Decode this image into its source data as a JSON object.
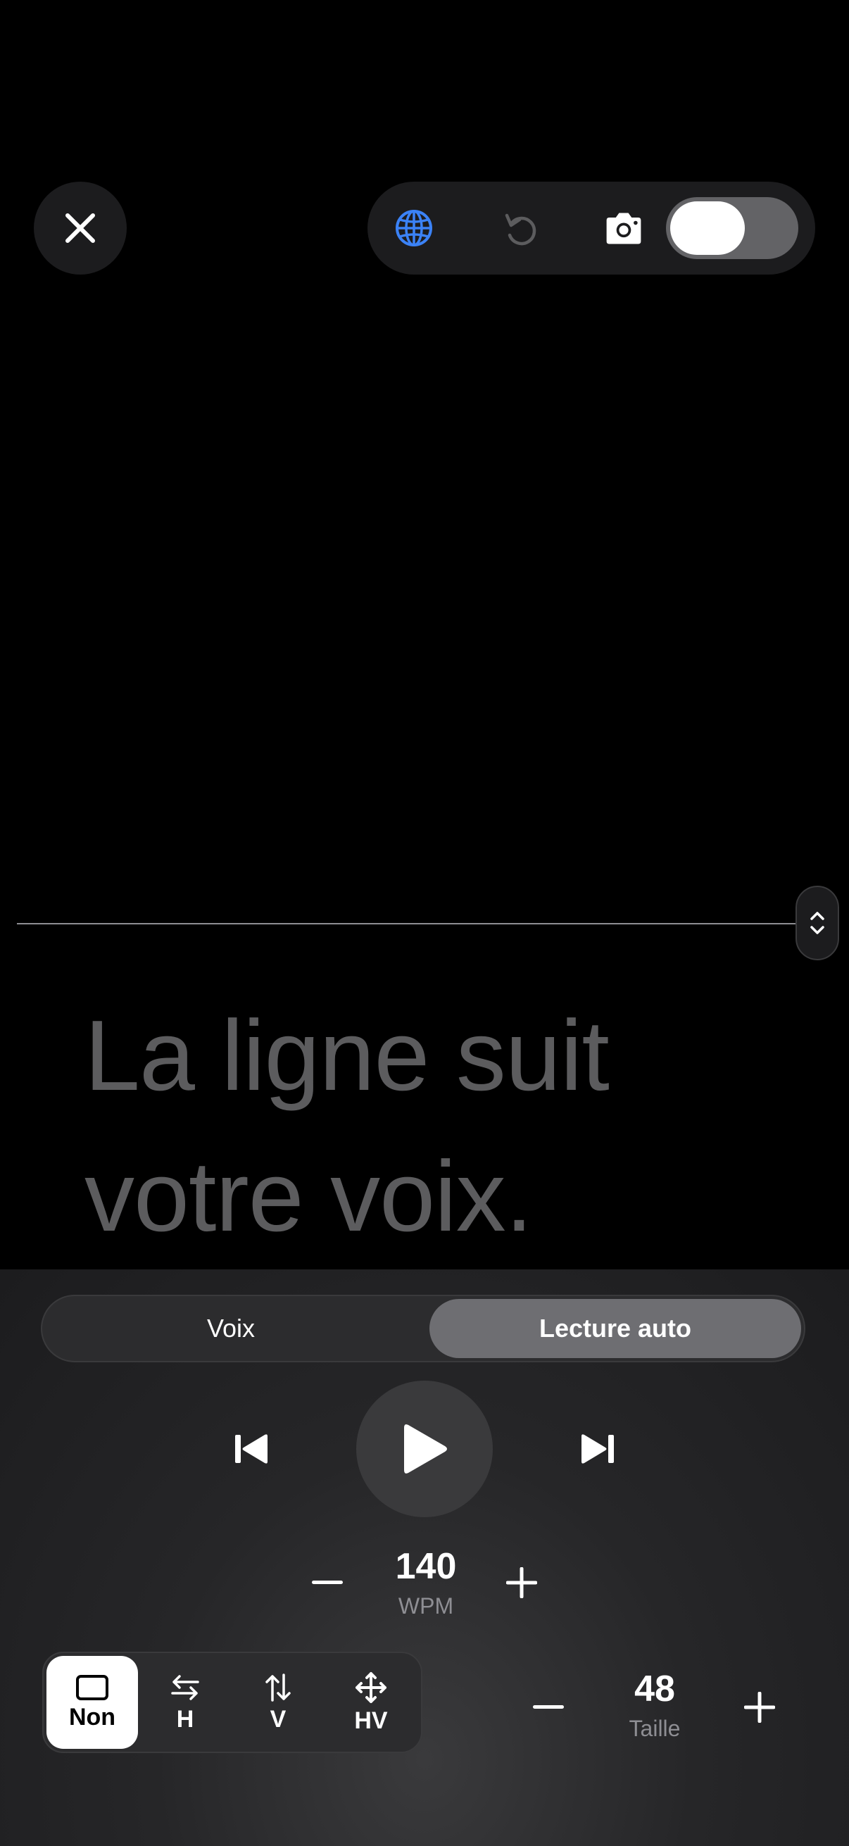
{
  "script_text": {
    "line1": "La ligne suit",
    "line2": "votre voix."
  },
  "toolbar": {
    "icons": [
      "globe-icon",
      "undo-icon",
      "camera-icon"
    ],
    "toggle_on": true
  },
  "mode_tabs": {
    "voice": "Voix",
    "auto": "Lecture auto",
    "selected": "auto"
  },
  "speed": {
    "value": "140",
    "unit": "WPM"
  },
  "mirror": {
    "options": [
      {
        "label": "Non",
        "icon": "square-icon"
      },
      {
        "label": "H",
        "icon": "arrows-horizontal-icon"
      },
      {
        "label": "V",
        "icon": "arrows-vertical-icon"
      },
      {
        "label": "HV",
        "icon": "arrows-move-icon"
      }
    ],
    "selected": "Non"
  },
  "font_size": {
    "value": "48",
    "unit": "Taille"
  },
  "colors": {
    "accent_blue": "#3b82f6",
    "panel_bg": "#1c1c1e",
    "script_text": "#5c5c5e"
  }
}
